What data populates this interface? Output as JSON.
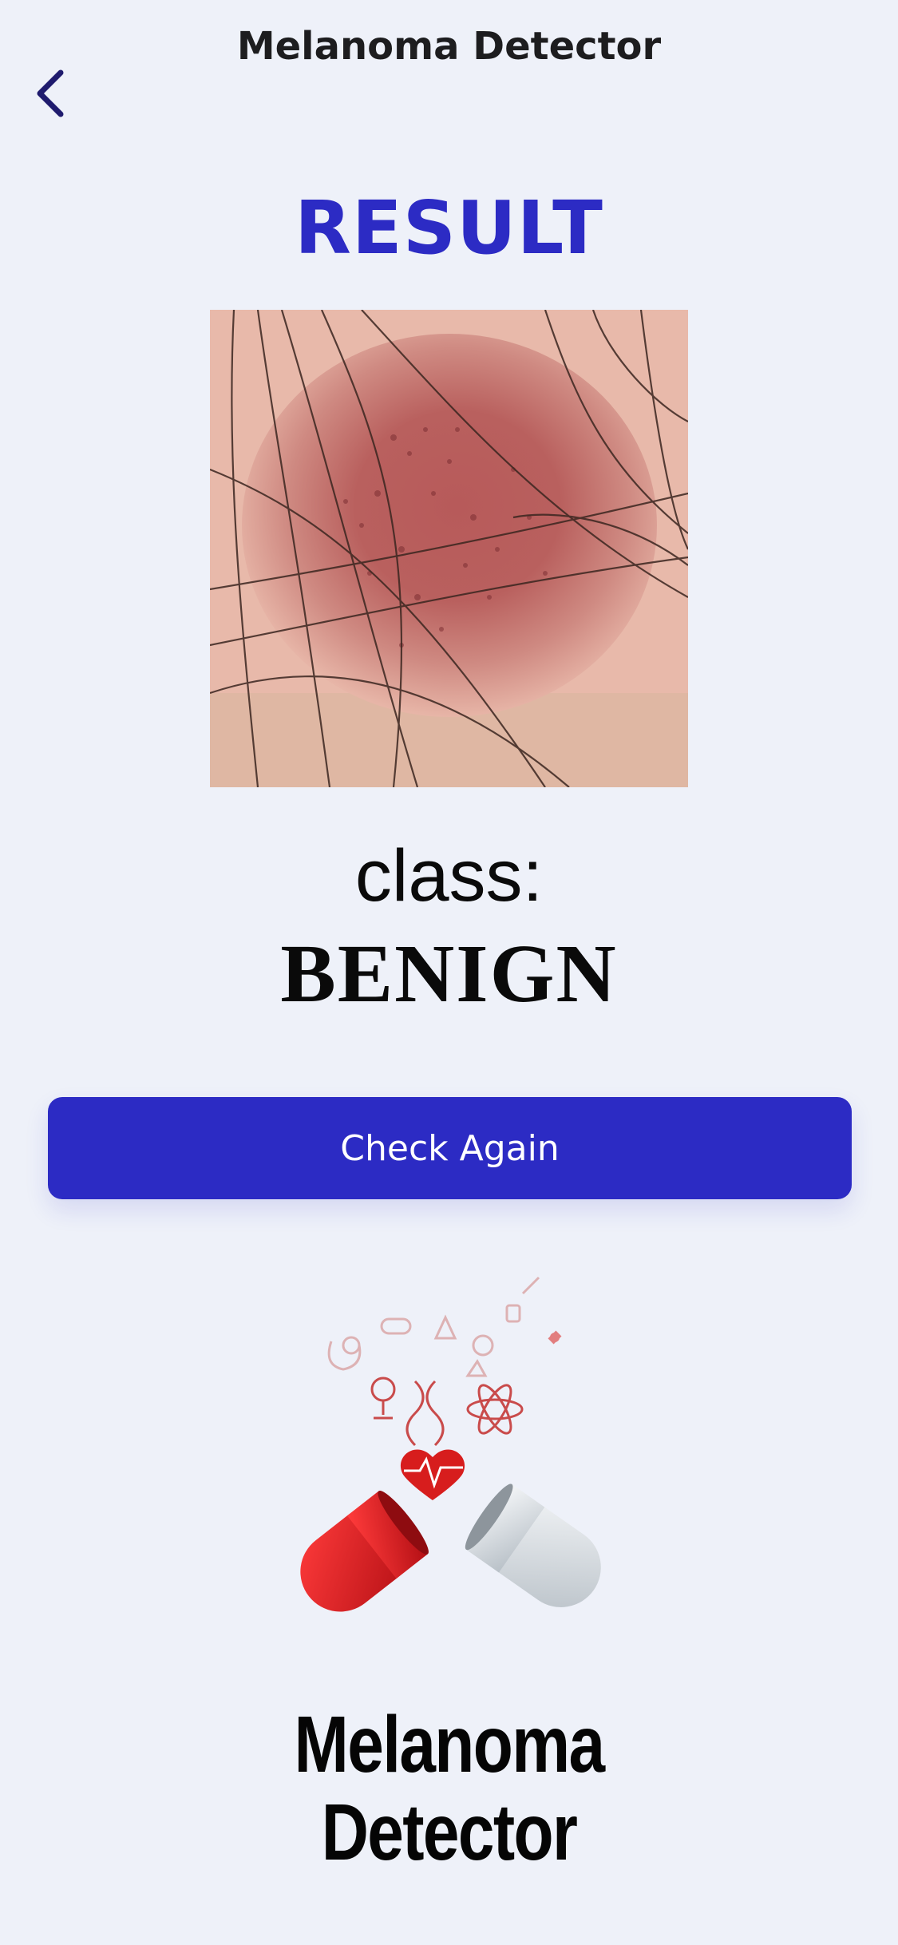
{
  "header": {
    "title": "Melanoma Detector"
  },
  "main": {
    "heading": "RESULT",
    "class_label": "class:",
    "class_value": "BENIGN",
    "check_again_label": "Check Again"
  },
  "logo": {
    "line1": "Melanoma",
    "line2": "Detector"
  },
  "colors": {
    "accent": "#2c2bc4",
    "background": "#eef1f9",
    "back_icon": "#1f1b6e"
  },
  "icons": {
    "back": "chevron-left-icon"
  }
}
